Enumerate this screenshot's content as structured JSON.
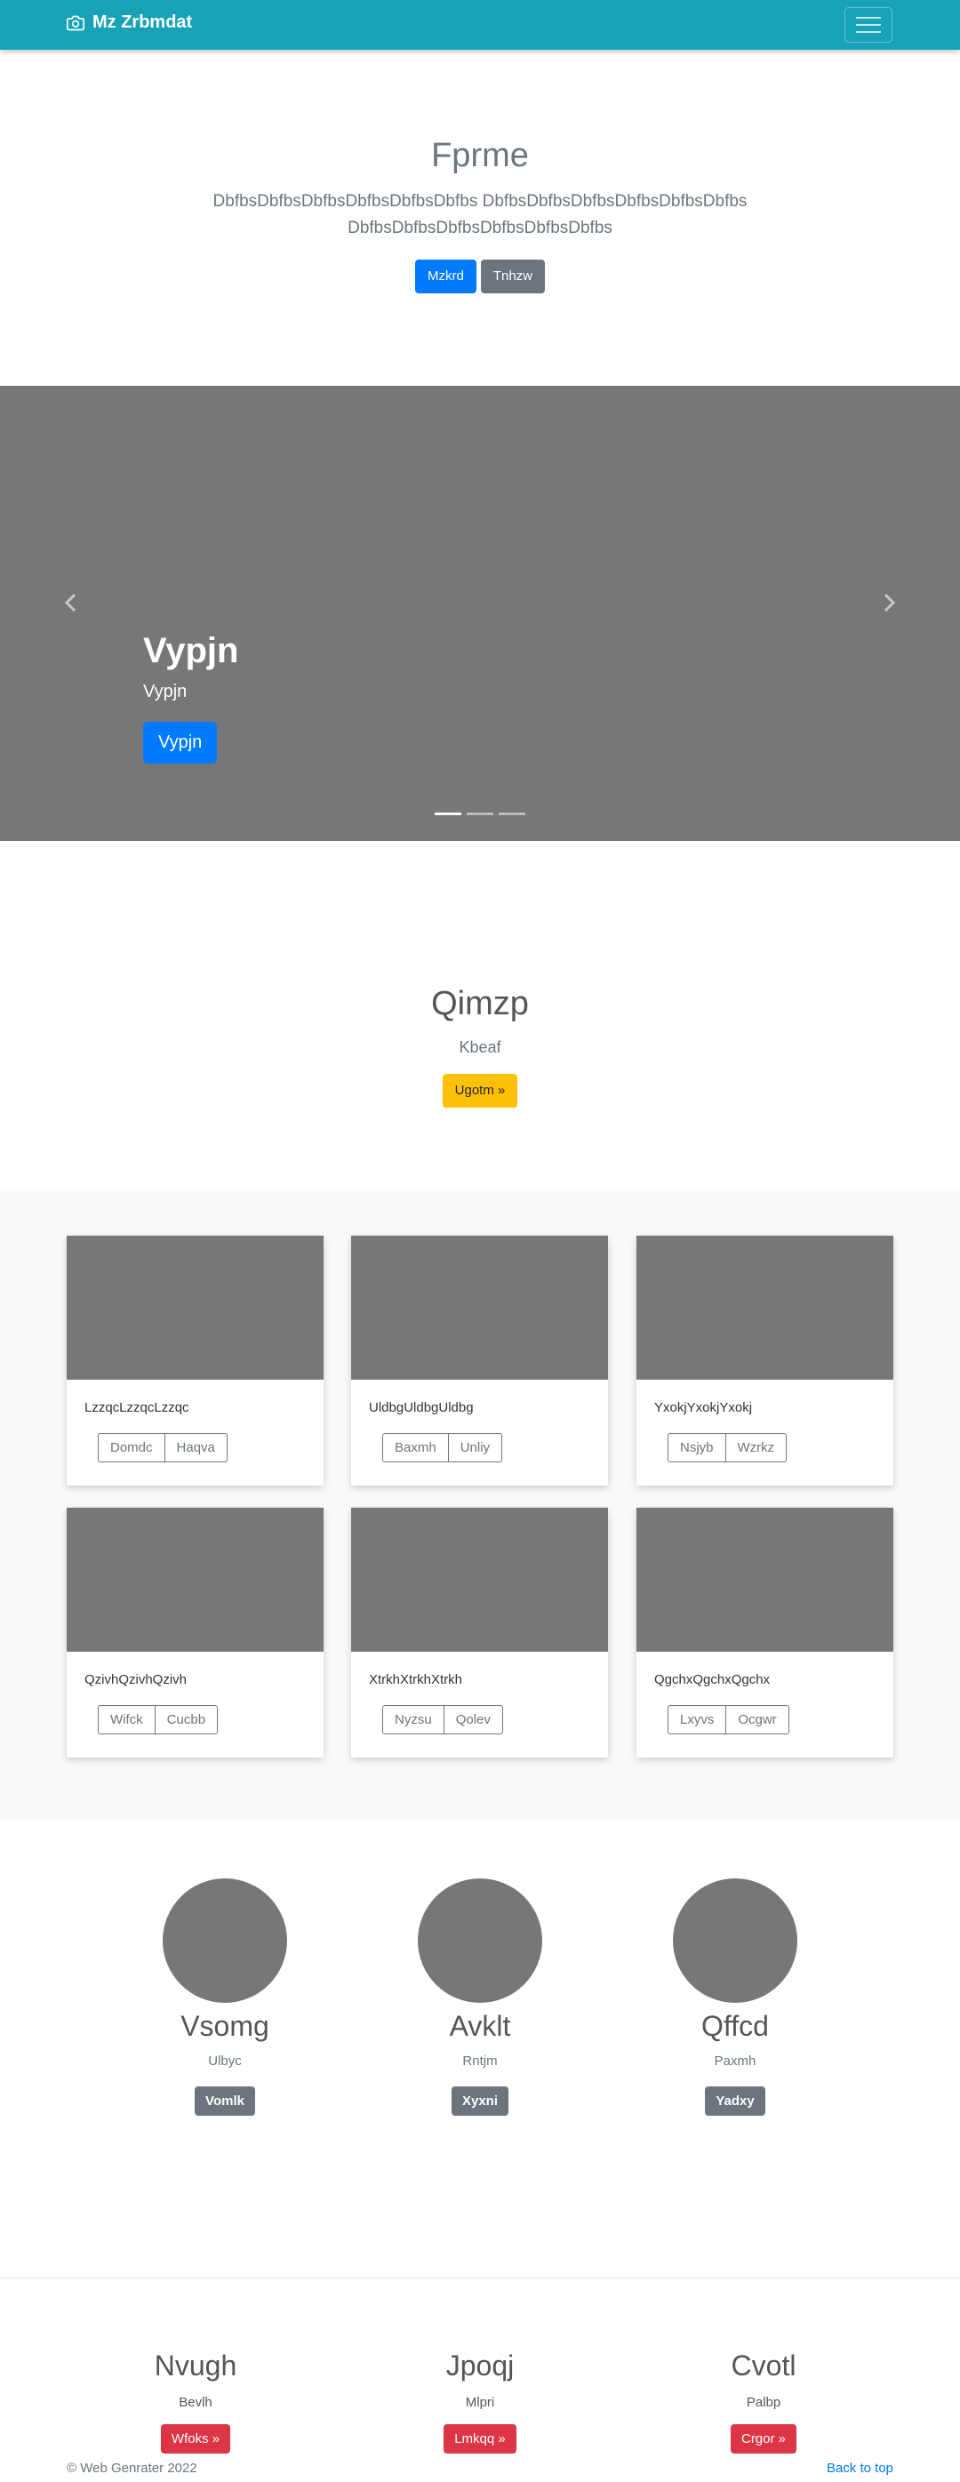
{
  "navbar": {
    "brand": "Mz Zrbmdat",
    "brand_icon": "camera-icon",
    "toggle_icon": "hamburger-icon"
  },
  "hero": {
    "title": "Fprme",
    "lead": "DbfbsDbfbsDbfbsDbfbsDbfbsDbfbs DbfbsDbfbsDbfbsDbfbsDbfbsDbfbs DbfbsDbfbsDbfbsDbfbsDbfbsDbfbs",
    "primary_button": "Mzkrd",
    "secondary_button": "Tnhzw"
  },
  "carousel": {
    "title": "Vypjn",
    "subtitle": "Vypjn",
    "button": "Vypjn",
    "slide_count": 3,
    "active_slide": 1,
    "prev_icon": "chevron-left-icon",
    "next_icon": "chevron-right-icon"
  },
  "feature": {
    "title": "Qimzp",
    "subtitle": "Kbeaf",
    "button": "Ugotm »"
  },
  "album": {
    "cards": [
      {
        "text": "LzzqcLzzqcLzzqc",
        "btn1": "Domdc",
        "btn2": "Haqva"
      },
      {
        "text": "UldbgUldbgUldbg",
        "btn1": "Baxmh",
        "btn2": "Unliy"
      },
      {
        "text": "YxokjYxokjYxokj",
        "btn1": "Nsjyb",
        "btn2": "Wzrkz"
      },
      {
        "text": "QzivhQzivhQzivh",
        "btn1": "Wifck",
        "btn2": "Cucbb"
      },
      {
        "text": "XtrkhXtrkhXtrkh",
        "btn1": "Nyzsu",
        "btn2": "Qolev"
      },
      {
        "text": "QgchxQgchxQgchx",
        "btn1": "Lxyvs",
        "btn2": "Ocgwr"
      }
    ]
  },
  "team": [
    {
      "name": "Vsomg",
      "role": "Ulbyc",
      "button": "Vomlk"
    },
    {
      "name": "Avklt",
      "role": "Rntjm",
      "button": "Xyxni"
    },
    {
      "name": "Qffcd",
      "role": "Paxmh",
      "button": "Yadxy"
    }
  ],
  "pricing": [
    {
      "name": "Nvugh",
      "sub": "Bevlh",
      "button": "Wfoks »"
    },
    {
      "name": "Jpoqj",
      "sub": "Mlpri",
      "button": "Lmkqq »"
    },
    {
      "name": "Cvotl",
      "sub": "Palbp",
      "button": "Crgor »"
    }
  ],
  "footer": {
    "copyright": "© Web Genrater 2022",
    "back_to_top": "Back to top"
  },
  "colors": {
    "navbar": "#17a2b8",
    "primary": "#007bff",
    "secondary": "#6c757d",
    "warning": "#ffc107",
    "danger": "#dc3545",
    "placeholder": "#777777"
  }
}
